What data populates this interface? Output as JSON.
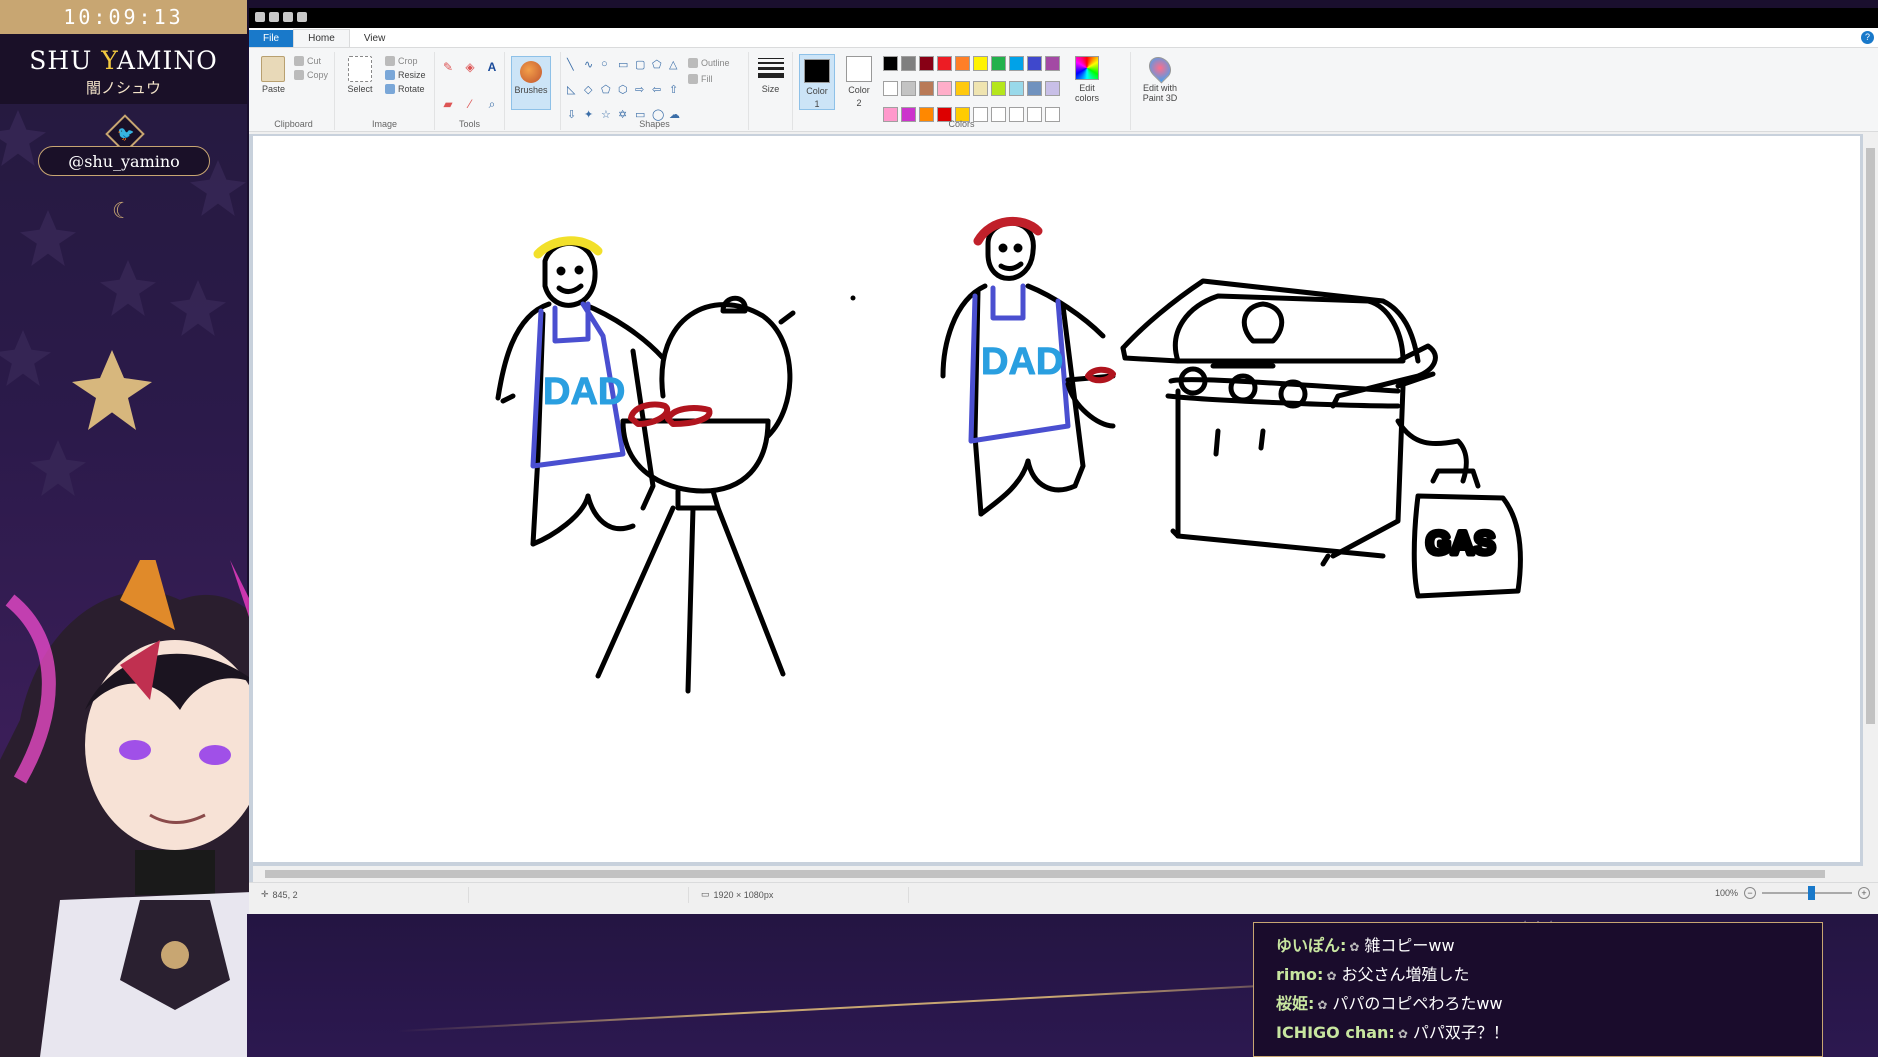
{
  "overlay": {
    "clock": "10:09:13",
    "name_part1": "SHU ",
    "name_y": "Y",
    "name_part2": "AMINO",
    "name_kana": "闇ノシュウ",
    "twitter_handle": "@shu_yamino"
  },
  "paint": {
    "tabs": {
      "file": "File",
      "home": "Home",
      "view": "View"
    },
    "clipboard": {
      "paste": "Paste",
      "cut": "Cut",
      "copy": "Copy",
      "label": "Clipboard"
    },
    "image": {
      "select": "Select",
      "crop": "Crop",
      "resize": "Resize",
      "rotate": "Rotate",
      "label": "Image"
    },
    "tools": {
      "label": "Tools"
    },
    "brushes": "Brushes",
    "shapes": {
      "outline": "Outline",
      "fill": "Fill",
      "label": "Shapes"
    },
    "size": "Size",
    "color1": {
      "label": "Color",
      "num": "1",
      "value": "#000000"
    },
    "color2": {
      "label": "Color",
      "num": "2",
      "value": "#ffffff"
    },
    "colors_label": "Colors",
    "edit_colors": "Edit colors",
    "paint3d": "Edit with Paint 3D",
    "palette": [
      "#000000",
      "#7f7f7f",
      "#880015",
      "#ed1c24",
      "#ff7f27",
      "#fff200",
      "#22b14c",
      "#00a2e8",
      "#3f48cc",
      "#a349a4",
      "#ffffff",
      "#c3c3c3",
      "#b97a57",
      "#ffaec9",
      "#ffc90e",
      "#efe4b0",
      "#b5e61d",
      "#99d9ea",
      "#7092be",
      "#c8bfe7",
      "#ff99cc",
      "#cc33cc",
      "#ff8800",
      "#dd0000",
      "#ffcc00",
      "#ffffff",
      "#ffffff",
      "#ffffff",
      "#ffffff",
      "#ffffff"
    ],
    "status": {
      "cursor": "845, 2",
      "dims": "1920 × 1080px",
      "zoom": "100%"
    }
  },
  "drawing": {
    "apron_text_left": "DAD",
    "apron_text_right": "DAD",
    "tank_label": "GAS",
    "hair_left_color": "#f2e02a",
    "hair_right_color": "#c0202a",
    "apron_color": "#4a4fd0",
    "apron_text_color": "#2a9fe0",
    "meat_color": "#b0141e"
  },
  "chat": [
    {
      "user": "ゆいぽん:",
      "msg": "雑コピーww"
    },
    {
      "user": "rimo:",
      "msg": "お父さん増殖した"
    },
    {
      "user": "桜姫:",
      "msg": "パパのコピペわろたww"
    },
    {
      "user": "ICHIGO chan:",
      "msg": "パパ双子？！"
    }
  ]
}
